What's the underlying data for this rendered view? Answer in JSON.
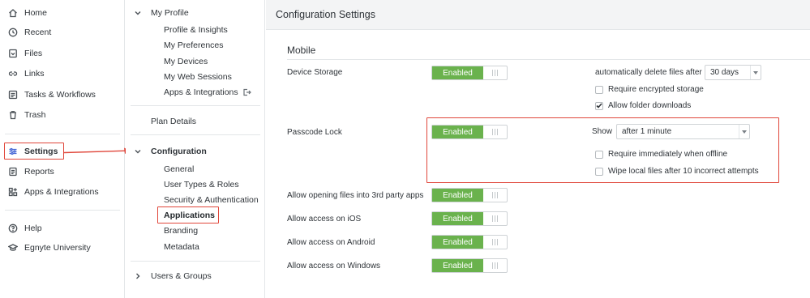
{
  "nav": {
    "items": [
      {
        "label": "Home",
        "icon": "home-icon"
      },
      {
        "label": "Recent",
        "icon": "clock-icon"
      },
      {
        "label": "Files",
        "icon": "files-icon"
      },
      {
        "label": "Links",
        "icon": "link-icon"
      },
      {
        "label": "Tasks & Workflows",
        "icon": "tasks-icon"
      },
      {
        "label": "Trash",
        "icon": "trash-icon"
      },
      {
        "label": "Settings",
        "icon": "sliders-icon"
      },
      {
        "label": "Reports",
        "icon": "report-icon"
      },
      {
        "label": "Apps & Integrations",
        "icon": "apps-icon"
      },
      {
        "label": "Help",
        "icon": "help-icon"
      },
      {
        "label": "Egnyte University",
        "icon": "graduation-cap-icon"
      }
    ]
  },
  "subnav": {
    "my_profile": {
      "label": "My Profile",
      "items": [
        "Profile & Insights",
        "My Preferences",
        "My Devices",
        "My Web Sessions",
        "Apps & Integrations"
      ]
    },
    "plan_details": "Plan Details",
    "configuration": {
      "label": "Configuration",
      "items": [
        "General",
        "User Types & Roles",
        "Security & Authentication",
        "Applications",
        "Branding",
        "Metadata"
      ]
    },
    "users_groups": "Users & Groups"
  },
  "main": {
    "title": "Configuration Settings",
    "section": "Mobile",
    "rows": [
      {
        "label": "Device Storage",
        "toggle": "Enabled"
      },
      {
        "label": "Passcode Lock",
        "toggle": "Enabled"
      },
      {
        "label": "Allow opening files into 3rd party apps",
        "toggle": "Enabled"
      },
      {
        "label": "Allow access on iOS",
        "toggle": "Enabled"
      },
      {
        "label": "Allow access on Android",
        "toggle": "Enabled"
      },
      {
        "label": "Allow access on Windows",
        "toggle": "Enabled"
      }
    ],
    "device_storage": {
      "auto_delete_label": "automatically delete files after",
      "auto_delete_value": "30 days",
      "require_encrypted": {
        "label": "Require encrypted storage",
        "checked": false
      },
      "allow_folder_downloads": {
        "label": "Allow folder downloads",
        "checked": true
      }
    },
    "passcode": {
      "show_label": "Show",
      "show_value": "after 1 minute",
      "require_offline": {
        "label": "Require immediately when offline",
        "checked": false
      },
      "wipe_files": {
        "label": "Wipe local files after 10 incorrect attempts",
        "checked": false
      }
    }
  },
  "colors": {
    "accent_green": "#6ab24d",
    "highlight_red": "#e0463a"
  }
}
